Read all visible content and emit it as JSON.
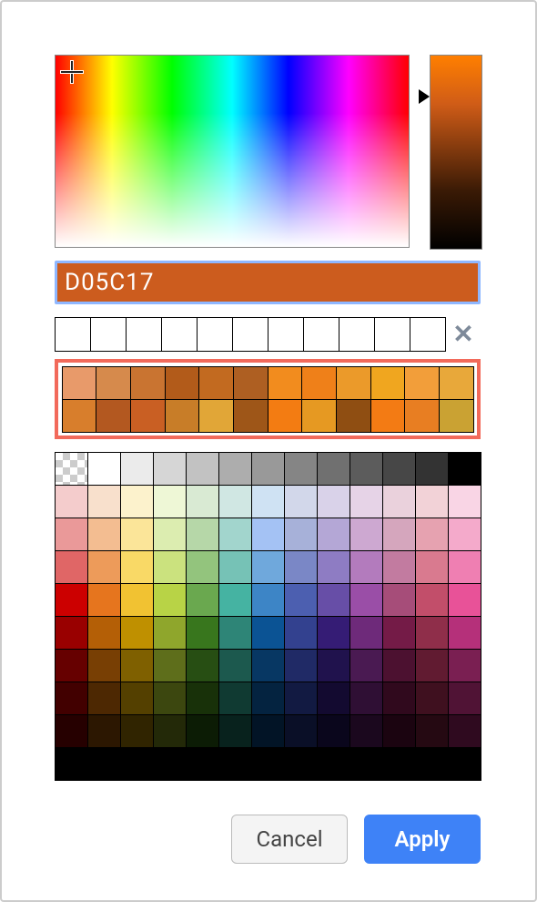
{
  "hex_input": {
    "value": "D05C17"
  },
  "spectrum": {
    "crosshair_pos": "top-left",
    "brightness_marker_pct": 18
  },
  "recents": {
    "count_slots": 11,
    "slots": [
      "",
      "",
      "",
      "",
      "",
      "",
      "",
      "",
      "",
      "",
      ""
    ]
  },
  "suggested_colors": [
    "#e89a6a",
    "#d68a4c",
    "#c97431",
    "#b25b1a",
    "#c26a20",
    "#ae5f22",
    "#f28c1e",
    "#ef8019",
    "#eb9a2a",
    "#f0a61f",
    "#f29e3a",
    "#e8a83a",
    "#d87e2c",
    "#b35820",
    "#c95f23",
    "#c87d28",
    "#e1a637",
    "#9e5618",
    "#f37c12",
    "#e69922",
    "#8f4e12",
    "#f37b14",
    "#e87e22",
    "#caa233"
  ],
  "palette": [
    "TRANSPARENT",
    "#ffffff",
    "#ebebeb",
    "#d6d6d6",
    "#c2c2c2",
    "#adadad",
    "#999999",
    "#858585",
    "#707070",
    "#5c5c5c",
    "#474747",
    "#333333",
    "#000000",
    "#f4cccc",
    "#f8e0cc",
    "#fcf2cc",
    "#eef7d6",
    "#d9ead3",
    "#d0e7e3",
    "#cfe2f3",
    "#d2d7ea",
    "#d9d2e9",
    "#e6d3e7",
    "#ead1dc",
    "#f2d2d7",
    "#f9d5e5",
    "#ea9999",
    "#f3bd91",
    "#fbe599",
    "#dcedb0",
    "#b6d7a8",
    "#a2d5cd",
    "#a4c2f4",
    "#a7b1d9",
    "#b4a7d6",
    "#cda8d1",
    "#d5a6bd",
    "#e6a2b0",
    "#f4aacb",
    "#e06666",
    "#ed9b5a",
    "#f9d966",
    "#cbe27e",
    "#93c47d",
    "#76c2b6",
    "#6fa8dc",
    "#7a87c6",
    "#8e7cc3",
    "#b37bbd",
    "#c27ba0",
    "#d97a8f",
    "#ef7fb2",
    "#cc0000",
    "#e6751e",
    "#f1c232",
    "#b8d346",
    "#6aa84f",
    "#45b3a2",
    "#3d85c6",
    "#4c5fb0",
    "#674ea7",
    "#9a4ea7",
    "#a64d79",
    "#c24e6a",
    "#e85298",
    "#990000",
    "#b45f06",
    "#bf9000",
    "#8fa62c",
    "#38761d",
    "#2e8577",
    "#0b5394",
    "#33418f",
    "#351c75",
    "#6e2a7a",
    "#741b47",
    "#8f2e4a",
    "#b5307a",
    "#660000",
    "#783f04",
    "#7f6000",
    "#5e6e1b",
    "#274e13",
    "#1c594e",
    "#073763",
    "#202a66",
    "#20124d",
    "#4a1a52",
    "#4c1130",
    "#611b31",
    "#7a1f52",
    "#420000",
    "#4d2802",
    "#544000",
    "#3c470f",
    "#183109",
    "#103a32",
    "#042340",
    "#121a42",
    "#130a30",
    "#2f0f34",
    "#30091d",
    "#3f101f",
    "#501335",
    "#260000",
    "#2c1701",
    "#302400",
    "#232908",
    "#0c1c05",
    "#08221d",
    "#021426",
    "#0a0f27",
    "#0a061c",
    "#1b081e",
    "#1b0410",
    "#250912",
    "#2f0a1f",
    "#000000",
    "#000000",
    "#000000",
    "#000000",
    "#000000",
    "#000000",
    "#000000",
    "#000000",
    "#000000",
    "#000000",
    "#000000",
    "#000000",
    "#000000"
  ],
  "buttons": {
    "cancel": "Cancel",
    "apply": "Apply"
  },
  "colors": {
    "selection_ring": "#8fb7ff",
    "suggested_highlight": "#f26a5b",
    "apply_bg": "#3e82f7",
    "hex_field_bg": "#cc5c1e"
  }
}
